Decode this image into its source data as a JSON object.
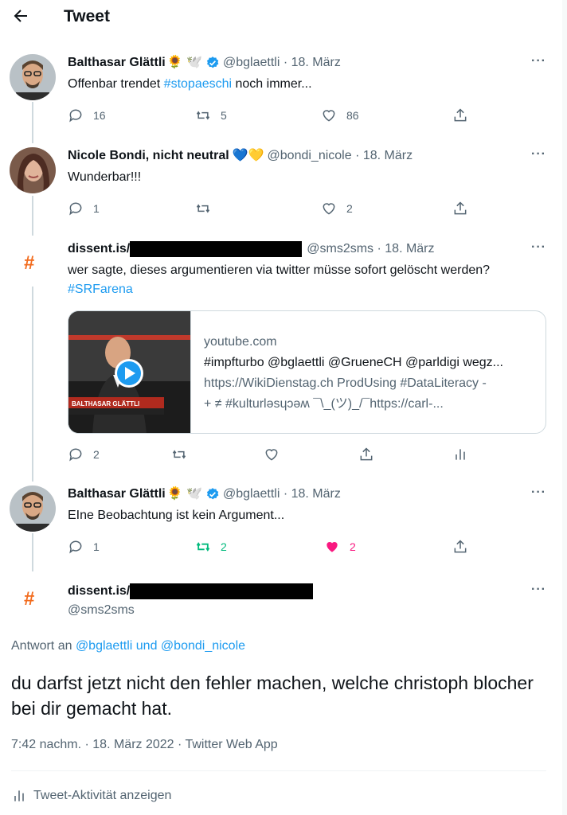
{
  "header": {
    "title": "Tweet"
  },
  "tweets": [
    {
      "name": "Balthasar Glättli",
      "emoji": "🌻 🕊️",
      "handle": "@bglaettli",
      "date": "18. März",
      "text_before": "Offenbar trendet ",
      "hashtag": "#stopaeschi",
      "text_after": " noch immer...",
      "replies": "16",
      "retweets": "5",
      "likes": "86"
    },
    {
      "name": "Nicole Bondi, nicht neutral",
      "emoji": "💙💛",
      "handle": "@bondi_nicole",
      "date": "18. März",
      "text": "Wunderbar!!!",
      "replies": "1",
      "retweets": "",
      "likes": "2"
    },
    {
      "name": "dissent.is/",
      "handle": "@sms2sms",
      "date": "18. März",
      "text": "wer sagte, dieses argumentieren via twitter müsse sofort gelöscht werden?",
      "hashtag": "#SRFarena",
      "card": {
        "domain": "youtube.com",
        "title": "#impfturbo @bglaettli @GrueneCH @parldigi wegz...",
        "desc_1": "https://WikiDienstag.ch ProdUsing #DataLiteracy -",
        "desc_2": "+ ≠ #kulturləsɥɔəʍ ¯\\_(ツ)_/¯https://carl-...",
        "thumb_label": "BALTHASAR GLÄTTLI"
      },
      "replies": "2",
      "retweets": "",
      "likes": ""
    },
    {
      "name": "Balthasar Glättli",
      "emoji": "🌻 🕊️",
      "handle": "@bglaettli",
      "date": "18. März",
      "text": "EIne Beobachtung ist kein Argument...",
      "replies": "1",
      "retweets": "2",
      "likes": "2"
    }
  ],
  "main_tweet": {
    "name": "dissent.is/",
    "handle": "@sms2sms",
    "reply_prefix": "Antwort an ",
    "reply_user_1": "@bglaettli",
    "reply_and": " und ",
    "reply_user_2": "@bondi_nicole",
    "text": "du darfst jetzt nicht den fehler machen, welche christoph blocher bei dir gemacht hat.",
    "timestamp": "7:42 nachm. · 18. März 2022 · Twitter Web App",
    "activity_label": "Tweet-Aktivität anzeigen"
  },
  "colors": {
    "accent": "#1d9bf0",
    "retweet_active": "#00ba7c",
    "like_active": "#f91880",
    "hash_avatar": "#f26b1d"
  }
}
